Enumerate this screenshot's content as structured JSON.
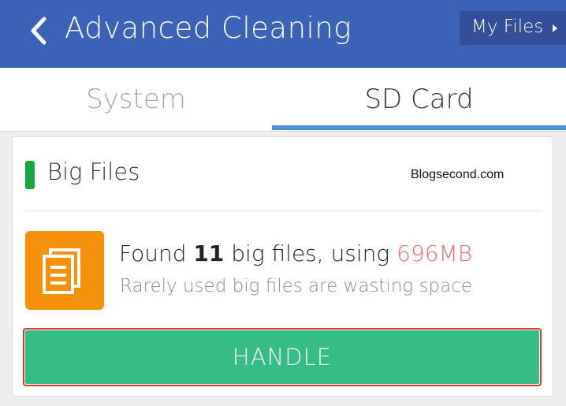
{
  "header": {
    "title": "Advanced Cleaning",
    "back_icon": "chevron-left-icon",
    "my_files_label": "My Files",
    "my_files_icon": "caret-right-icon",
    "background_color": "#3a63b8"
  },
  "tabs": [
    {
      "label": "System",
      "active": false
    },
    {
      "label": "SD Card",
      "active": true
    }
  ],
  "card": {
    "section_title": "Big Files",
    "section_marker_color": "#16a83f",
    "watermark": "Blogsecond.com",
    "icon": "documents-icon",
    "icon_tile_color": "#f5910b",
    "found_prefix": "Found ",
    "file_count": "11",
    "found_middle": " big files, using ",
    "total_size": "696MB",
    "subtext": "Rarely used big files are wasting space",
    "handle_label": "HANDLE",
    "handle_color": "#35bd85"
  }
}
